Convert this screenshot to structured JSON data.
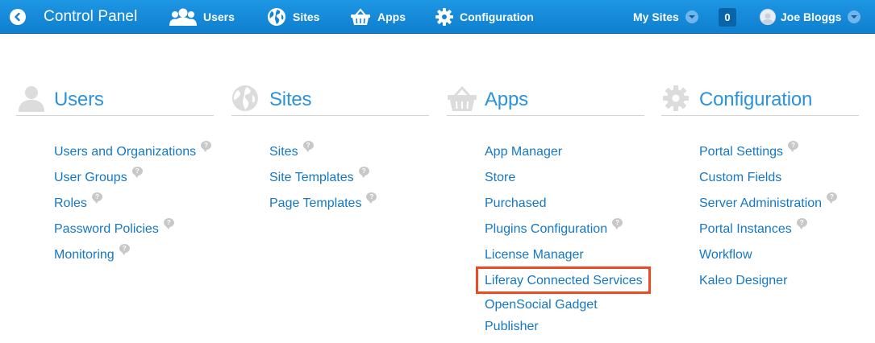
{
  "topbar": {
    "title": "Control Panel",
    "nav": [
      {
        "label": "Users",
        "icon": "users-icon"
      },
      {
        "label": "Sites",
        "icon": "globe-icon"
      },
      {
        "label": "Apps",
        "icon": "basket-icon"
      },
      {
        "label": "Configuration",
        "icon": "gear-icon"
      }
    ],
    "my_sites": "My Sites",
    "notification_count": "0",
    "user_name": "Joe Bloggs"
  },
  "columns": [
    {
      "title": "Users",
      "icon": "users-icon",
      "items": [
        {
          "label": "Users and Organizations",
          "help": true
        },
        {
          "label": "User Groups",
          "help": true
        },
        {
          "label": "Roles",
          "help": true
        },
        {
          "label": "Password Policies",
          "help": true
        },
        {
          "label": "Monitoring",
          "help": true
        }
      ]
    },
    {
      "title": "Sites",
      "icon": "globe-icon",
      "items": [
        {
          "label": "Sites",
          "help": true
        },
        {
          "label": "Site Templates",
          "help": true
        },
        {
          "label": "Page Templates",
          "help": true
        }
      ]
    },
    {
      "title": "Apps",
      "icon": "basket-icon",
      "items": [
        {
          "label": "App Manager",
          "help": false
        },
        {
          "label": "Store",
          "help": false
        },
        {
          "label": "Purchased",
          "help": false
        },
        {
          "label": "Plugins Configuration",
          "help": true
        },
        {
          "label": "License Manager",
          "help": false
        },
        {
          "label": "Liferay Connected Services",
          "help": false
        },
        {
          "label": "OpenSocial Gadget Publisher",
          "help": false
        }
      ]
    },
    {
      "title": "Configuration",
      "icon": "gear-icon",
      "items": [
        {
          "label": "Portal Settings",
          "help": true
        },
        {
          "label": "Custom Fields",
          "help": false
        },
        {
          "label": "Server Administration",
          "help": true
        },
        {
          "label": "Portal Instances",
          "help": true
        },
        {
          "label": "Workflow",
          "help": false
        },
        {
          "label": "Kaleo Designer",
          "help": false
        }
      ]
    }
  ],
  "colors": {
    "topbar": "#1583d4",
    "link": "#1478c4",
    "heading": "#2a93de",
    "highlight": "#ee4a22"
  }
}
